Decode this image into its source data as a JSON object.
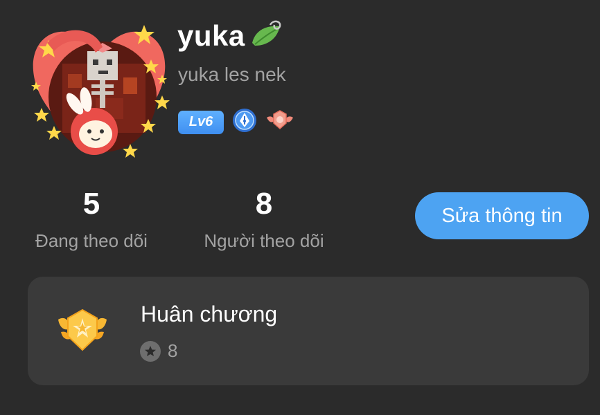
{
  "profile": {
    "username": "yuka",
    "display_name": "yuka les nek",
    "level_badge": "Lv6",
    "icons": [
      "leaf-icon",
      "pen-nib-badge-icon",
      "winged-medal-badge-icon"
    ]
  },
  "stats": {
    "following_count": "5",
    "following_label": "Đang theo dõi",
    "followers_count": "8",
    "followers_label": "Người theo dõi"
  },
  "actions": {
    "edit_label": "Sửa thông tin"
  },
  "medals": {
    "title": "Huân chương",
    "count": "8"
  },
  "colors": {
    "background": "#2b2b2b",
    "card": "#3a3a3a",
    "accent_button": "#4da3f2",
    "muted_text": "#a3a3a3",
    "level_badge": "#4f9ff5"
  }
}
